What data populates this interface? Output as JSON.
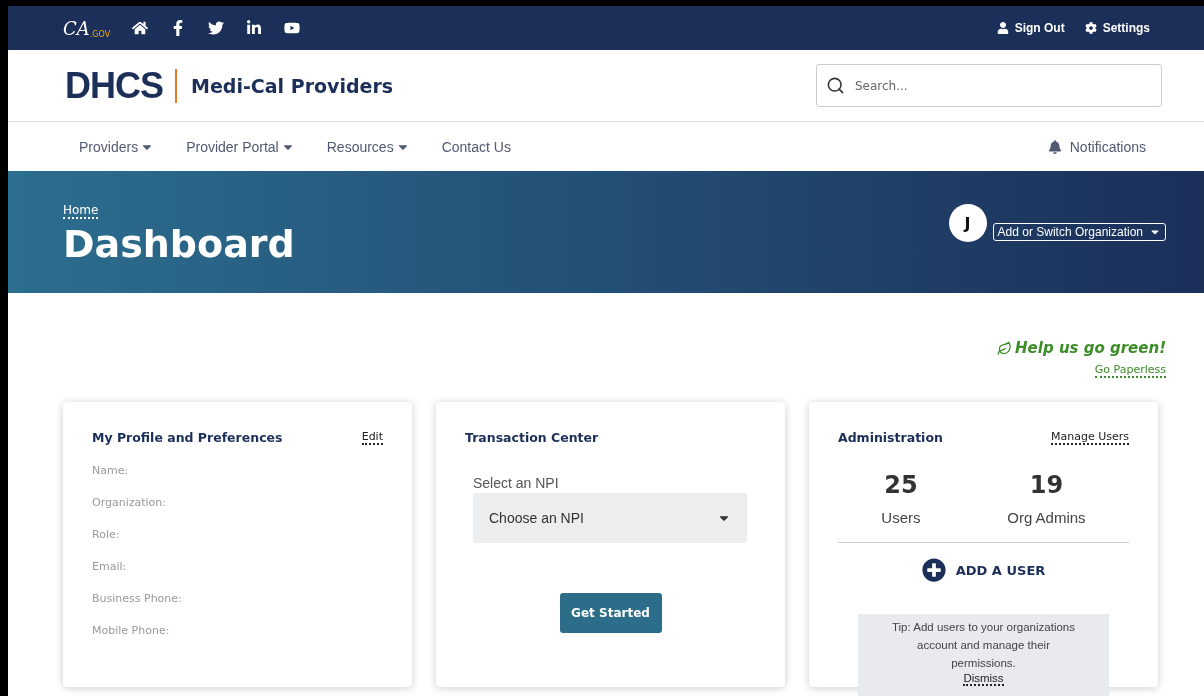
{
  "top_bar": {
    "gov_logo": {
      "main": "CA",
      "sub": ".GOV"
    },
    "social": [
      {
        "kind": "home"
      },
      {
        "kind": "facebook"
      },
      {
        "kind": "twitter"
      },
      {
        "kind": "linkedin"
      },
      {
        "kind": "youtube"
      }
    ],
    "links": [
      {
        "kind": "user",
        "label": "Sign Out"
      },
      {
        "kind": "settings",
        "label": "Settings"
      }
    ]
  },
  "header": {
    "logo": "DHCS",
    "site_name": "Medi-Cal Providers",
    "search": {
      "placeholder": "Search..."
    }
  },
  "nav": {
    "items": [
      {
        "label": "Providers",
        "has_menu": true
      },
      {
        "label": "Provider Portal",
        "has_menu": true
      },
      {
        "label": "Resources",
        "has_menu": true
      },
      {
        "label": "Contact Us",
        "has_menu": false
      }
    ],
    "notifications": "Notifications"
  },
  "hero": {
    "breadcrumb": "Home",
    "title": "Dashboard",
    "avatar": "J",
    "org_button": "Add or Switch Organization"
  },
  "green": {
    "title": "Help us go green!",
    "link": "Go Paperless"
  },
  "profile_card": {
    "title": "My Profile and Preferences",
    "edit": "Edit",
    "fields": [
      "Name:",
      "Organization:",
      "Role:",
      "Email:",
      "Business Phone:",
      "Mobile Phone:"
    ]
  },
  "transaction_card": {
    "title": "Transaction Center",
    "select_label": "Select an NPI",
    "select_value": "Choose an NPI",
    "button": "Get Started"
  },
  "admin_card": {
    "title": "Administration",
    "link": "Manage Users",
    "stats": [
      {
        "value": "25",
        "label": "Users"
      },
      {
        "value": "19",
        "label": "Org Admins"
      }
    ],
    "add_user": "ADD A USER",
    "tip": {
      "text": "Tip: Add users to your organizations account and manage their permissions.",
      "dismiss": "Dismiss"
    }
  }
}
